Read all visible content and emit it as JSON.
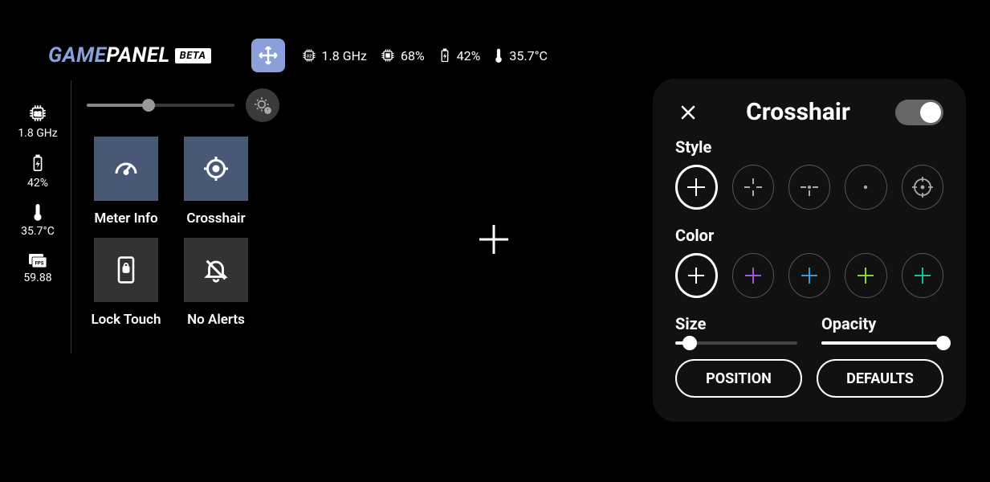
{
  "logo": {
    "game": "GAME",
    "panel": "PANEL",
    "badge": "BETA"
  },
  "topStats": {
    "cpuFreq": "1.8 GHz",
    "cpuLoad": "68%",
    "battery": "42%",
    "temp": "35.7°C"
  },
  "sidebar": {
    "cpuFreq": "1.8 GHz",
    "battery": "42%",
    "temp": "35.7°C",
    "fps": "59.88"
  },
  "brightness": {
    "percent": 42
  },
  "tiles": {
    "meterInfo": "Meter Info",
    "crosshair": "Crosshair",
    "lockTouch": "Lock Touch",
    "noAlerts": "No Alerts"
  },
  "crosshairPanel": {
    "title": "Crosshair",
    "enabled": true,
    "styleLabel": "Style",
    "colorLabel": "Color",
    "sizeLabel": "Size",
    "opacityLabel": "Opacity",
    "positionBtn": "POSITION",
    "defaultsBtn": "DEFAULTS",
    "stylesSelected": 0,
    "colorsSelected": 0,
    "colors": [
      "#ffffff",
      "#9b59d6",
      "#3498db",
      "#7fd837",
      "#1abc9c"
    ],
    "sizePercent": 12,
    "opacityPercent": 100
  }
}
